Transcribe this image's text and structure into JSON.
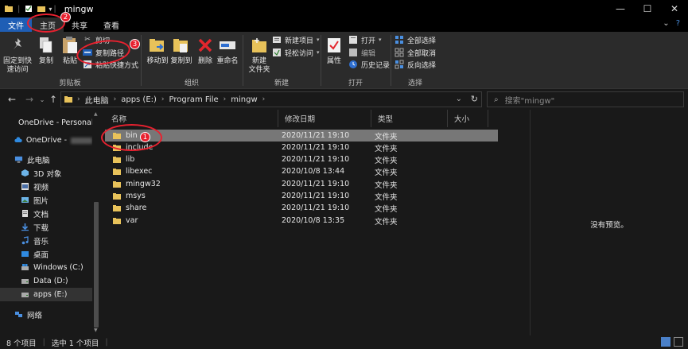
{
  "window": {
    "title": "mingw"
  },
  "tabs": [
    {
      "label": "文件"
    },
    {
      "label": "主页"
    },
    {
      "label": "共享"
    },
    {
      "label": "查看"
    }
  ],
  "ribbon": {
    "clipboard": {
      "label": "剪贴板",
      "pin": "固定到快\n速访问",
      "copy": "复制",
      "paste": "粘贴",
      "cut": "剪切",
      "copy_path": "复制路径",
      "paste_shortcut": "粘贴快捷方式"
    },
    "organize": {
      "label": "组织",
      "move_to": "移动到",
      "copy_to": "复制到",
      "delete": "删除",
      "rename": "重命名"
    },
    "new": {
      "label": "新建",
      "new_folder": "新建\n文件夹",
      "new_item": "新建项目",
      "easy_access": "轻松访问"
    },
    "open": {
      "label": "打开",
      "properties": "属性",
      "open": "打开",
      "edit": "编辑",
      "history": "历史记录"
    },
    "select": {
      "label": "选择",
      "select_all": "全部选择",
      "select_none": "全部取消",
      "invert": "反向选择"
    }
  },
  "address": {
    "crumbs": [
      "此电脑",
      "apps (E:)",
      "Program File",
      "mingw"
    ]
  },
  "search": {
    "placeholder": "搜索\"mingw\""
  },
  "nav": [
    {
      "label": "OneDrive - Personal",
      "icon": "cloud-icon"
    },
    {
      "label": "OneDrive -",
      "icon": "cloud-icon"
    },
    {
      "label": "此电脑",
      "icon": "computer-icon"
    },
    {
      "label": "3D 对象",
      "icon": "cube-icon"
    },
    {
      "label": "视频",
      "icon": "video-icon"
    },
    {
      "label": "图片",
      "icon": "picture-icon"
    },
    {
      "label": "文档",
      "icon": "document-icon"
    },
    {
      "label": "下载",
      "icon": "download-icon"
    },
    {
      "label": "音乐",
      "icon": "music-icon"
    },
    {
      "label": "桌面",
      "icon": "desktop-icon"
    },
    {
      "label": "Windows (C:)",
      "icon": "drive-icon"
    },
    {
      "label": "Data (D:)",
      "icon": "drive-icon"
    },
    {
      "label": "apps (E:)",
      "icon": "drive-icon"
    },
    {
      "label": "网络",
      "icon": "network-icon"
    }
  ],
  "columns": {
    "name": "名称",
    "date": "修改日期",
    "type": "类型",
    "size": "大小"
  },
  "files": [
    {
      "name": "bin",
      "date": "2020/11/21 19:10",
      "type": "文件夹"
    },
    {
      "name": "include",
      "date": "2020/11/21 19:10",
      "type": "文件夹"
    },
    {
      "name": "lib",
      "date": "2020/11/21 19:10",
      "type": "文件夹"
    },
    {
      "name": "libexec",
      "date": "2020/10/8 13:44",
      "type": "文件夹"
    },
    {
      "name": "mingw32",
      "date": "2020/11/21 19:10",
      "type": "文件夹"
    },
    {
      "name": "msys",
      "date": "2020/11/21 19:10",
      "type": "文件夹"
    },
    {
      "name": "share",
      "date": "2020/11/21 19:10",
      "type": "文件夹"
    },
    {
      "name": "var",
      "date": "2020/10/8 13:35",
      "type": "文件夹"
    }
  ],
  "preview": {
    "message": "没有预览。"
  },
  "status": {
    "count": "8 个项目",
    "selected": "选中 1 个项目"
  },
  "annotations": {
    "badge1": "1",
    "badge2": "2",
    "badge3": "3"
  },
  "colors": {
    "accent": "#1f5eb5",
    "annotation": "#e8212f",
    "folder": "#e8c25a",
    "selection": "#777777"
  }
}
